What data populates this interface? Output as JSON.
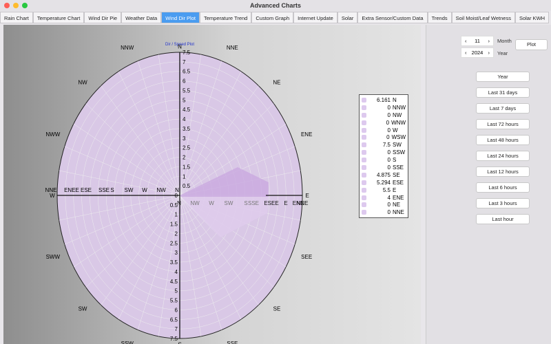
{
  "window": {
    "title": "Advanced Charts"
  },
  "tabs": [
    "Rain Chart",
    "Temperature Chart",
    "Wind Dir Pie",
    "Weather Data",
    "Wind Dir Plot",
    "Temperature Trend",
    "Custom Graph",
    "Internet Update",
    "Solar",
    "Extra Sensor/Custom Data",
    "Trends",
    "Soil Moist/Leaf Wetness",
    "Solar KWH"
  ],
  "active_tab": "Wind Dir Plot",
  "controls": {
    "month_value": "11",
    "month_label": "Month",
    "year_value": "2024",
    "year_label": "Year",
    "plot_label": "Plot",
    "prev": "‹",
    "next": "›",
    "ranges": [
      "Year",
      "Last 31 days",
      "Last 7 days",
      "Last 72 hours",
      "Last 48 hours",
      "Last 24 hours",
      "Last 12 hours",
      "Last 6 hours",
      "Last 3 hours",
      "Last hour"
    ]
  },
  "chart_data": {
    "type": "radar",
    "title": "Dir / Speed Plot",
    "color": "#ddc9ee",
    "rticks": [
      "0",
      "0.5",
      "1",
      "1.5",
      "2",
      "2.5",
      "3",
      "3.5",
      "4",
      "4.5",
      "5",
      "5.5",
      "6",
      "6.5",
      "7",
      "7.5"
    ],
    "compass": [
      "N",
      "NNE",
      "NE",
      "ENE",
      "E",
      "SEE",
      "SE",
      "SSE",
      "S",
      "SSW",
      "SW",
      "SWW",
      "W",
      "NWW",
      "NW",
      "NNW"
    ],
    "axis_labels_left": [
      "NNE",
      "ENEE",
      "ESE",
      "SSE",
      "S",
      "SW",
      "W",
      "NW",
      "N"
    ],
    "axis_labels_right": [
      "N",
      "NW",
      "W",
      "SW",
      "S",
      "SSE",
      "ESEE",
      "E",
      "ENE",
      "NNE"
    ],
    "series": [
      {
        "label": "N",
        "value": 6.161
      },
      {
        "label": "NNW",
        "value": 0
      },
      {
        "label": "NW",
        "value": 0
      },
      {
        "label": "WNW",
        "value": 0
      },
      {
        "label": "W",
        "value": 0
      },
      {
        "label": "WSW",
        "value": 0
      },
      {
        "label": "SW",
        "value": 7.5
      },
      {
        "label": "SSW",
        "value": 0
      },
      {
        "label": "S",
        "value": 0
      },
      {
        "label": "SSE",
        "value": 0
      },
      {
        "label": "SE",
        "value": 4.875
      },
      {
        "label": "ESE",
        "value": 5.294
      },
      {
        "label": "E",
        "value": 5.5
      },
      {
        "label": "ENE",
        "value": 4
      },
      {
        "label": "NE",
        "value": 0
      },
      {
        "label": "NNE",
        "value": 0
      }
    ]
  }
}
